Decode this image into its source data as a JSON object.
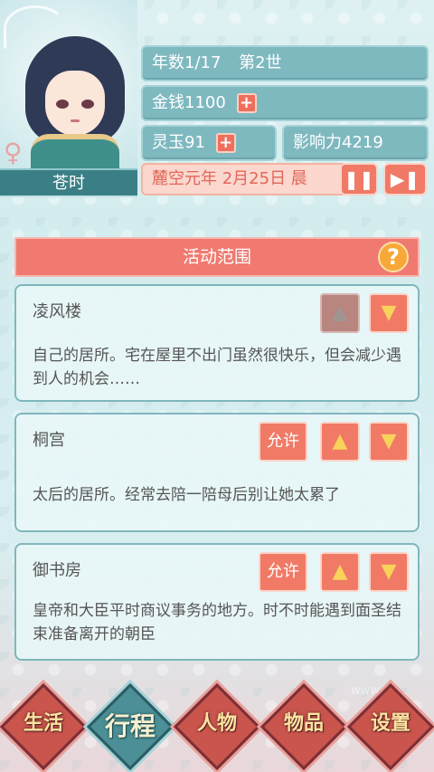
{
  "character": {
    "name": "苍时",
    "gender_icon": "female-icon"
  },
  "stats": {
    "years": "年数1/17",
    "generation": "第2世",
    "money_label": "金钱1100",
    "jade_label": "灵玉91",
    "influence_label": "影响力4219"
  },
  "date_text": "麓空元年 2月25日 晨",
  "section": {
    "title": "活动范围",
    "help_label": "?"
  },
  "locations": [
    {
      "title": "凌风楼",
      "description": "自己的居所。宅在屋里不出门虽然很快乐，但会减少遇到人的机会……",
      "allow_label": ""
    },
    {
      "title": "桐宫",
      "description": "太后的居所。经常去陪一陪母后别让她太累了",
      "allow_label": "允许"
    },
    {
      "title": "御书房",
      "description": "皇帝和大臣平时商议事务的地方。时不时能遇到面圣结束准备离开的朝臣",
      "allow_label": "允许"
    }
  ],
  "watermark": "www.kk...",
  "nav": [
    {
      "label": "生活",
      "active": false
    },
    {
      "label": "行程",
      "active": true
    },
    {
      "label": "人物",
      "active": false
    },
    {
      "label": "物品",
      "active": false
    },
    {
      "label": "设置",
      "active": false
    }
  ],
  "colors": {
    "accent": "#f07a66",
    "panel_teal": "#7fb9c0",
    "active_nav": "#4c8f96"
  }
}
